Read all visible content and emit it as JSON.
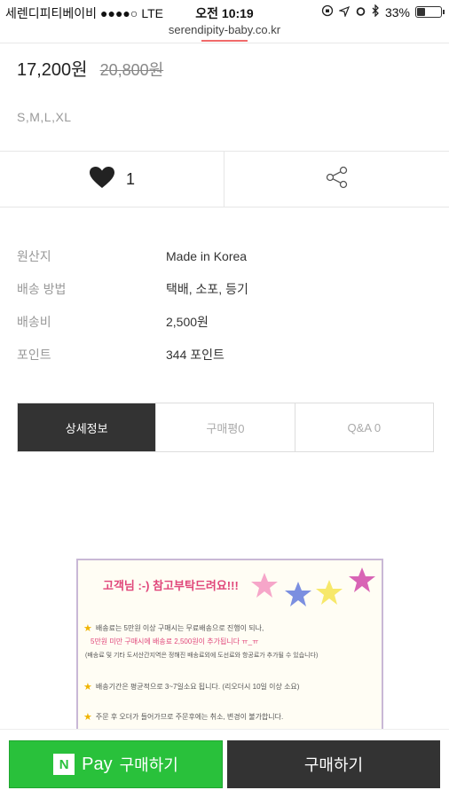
{
  "status_bar": {
    "carrier": "세렌디피티베이비",
    "signal": "●●●●○",
    "network": "LTE",
    "time": "오전 10:19",
    "battery": "33%",
    "battery_level": 0.33
  },
  "url": "serendipity-baby.co.kr",
  "product": {
    "price": "17,200원",
    "original_price": "20,800원",
    "sizes": "S,M,L,XL",
    "like_count": "1"
  },
  "info": [
    {
      "label": "원산지",
      "value": "Made in Korea"
    },
    {
      "label": "배송 방법",
      "value": "택배, 소포, 등기"
    },
    {
      "label": "배송비",
      "value": "2,500원"
    },
    {
      "label": "포인트",
      "value": "344 포인트"
    }
  ],
  "tabs": [
    {
      "label": "상세정보",
      "active": true
    },
    {
      "label": "구매평0",
      "active": false
    },
    {
      "label": "Q&A 0",
      "active": false
    }
  ],
  "notice": {
    "headline": "고객님 :-) 참고부탁드려요!!!",
    "lines": [
      "배송료는 5만원 이상 구매시는 무료배송으로 진행이 되나,",
      "5만원 미만 구매시에 배송료 2,500원이 추가됩니다 ㅠ_ㅠ",
      "(배송료 및 기타 도서산간지역은 정해진 배송료외에 도선료와 항공료가 추가될 수 있습니다)",
      "배송기간은 평균적으로 3~7일소요 됩니다. (리오더시 10일 이상 소요)",
      "주문 후 오더가 들어가므로 주문후에는 취소, 변경이 불가합니다."
    ]
  },
  "bottom": {
    "npay_logo": "N",
    "npay_brand": "Pay",
    "npay_label": "구매하기",
    "buy_label": "구매하기"
  },
  "colors": {
    "npay_green": "#29c13b",
    "dark": "#333333",
    "accent_pink": "#e0467a"
  }
}
